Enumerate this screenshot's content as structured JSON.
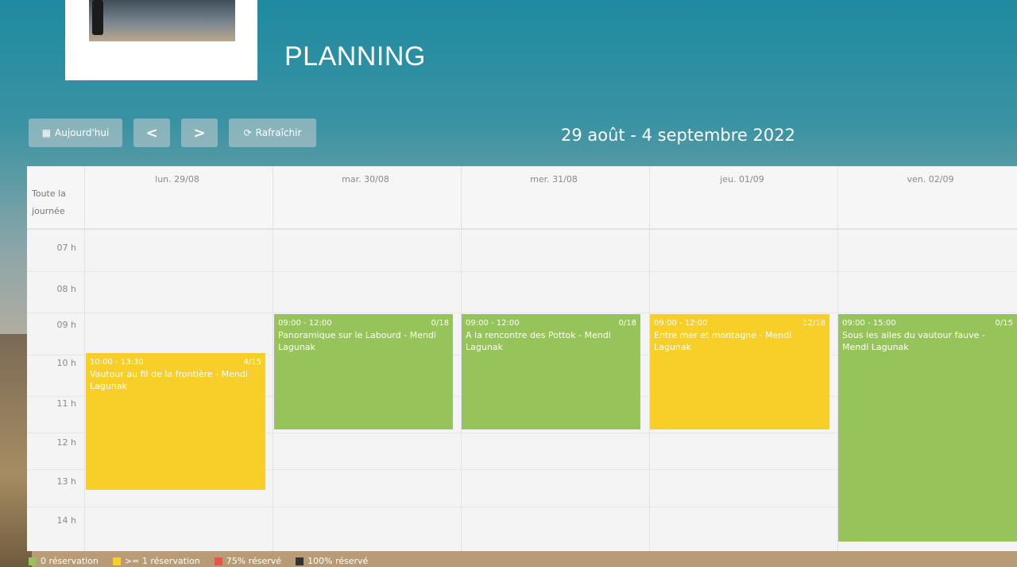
{
  "header": {
    "title": "PLANNING",
    "range": "29 août - 4 septembre 2022"
  },
  "toolbar": {
    "today_label": "Aujourd'hui",
    "prev_label": "<",
    "next_label": ">",
    "refresh_label": "Rafraîchir"
  },
  "calendar": {
    "allday_label_line1": "Toute la",
    "allday_label_line2": "journée",
    "days": [
      {
        "label": "lun. 29/08"
      },
      {
        "label": "mar. 30/08"
      },
      {
        "label": "mer. 31/08"
      },
      {
        "label": "jeu. 01/09"
      },
      {
        "label": "ven. 02/09"
      }
    ],
    "hours": [
      "07 h",
      "08 h",
      "09 h",
      "10 h",
      "11 h",
      "12 h",
      "13 h",
      "14 h"
    ],
    "events": [
      {
        "time": "10:00 - 13:30",
        "count": "4/15",
        "title": "Vautour au fil de la frontière - Mendi Lagunak",
        "status": "yellow"
      },
      {
        "time": "09:00 - 12:00",
        "count": "0/18",
        "title": "Panoramique sur le Labourd - Mendi Lagunak",
        "status": "green"
      },
      {
        "time": "09:00 - 12:00",
        "count": "0/18",
        "title": "A la rencontre des Pottok - Mendi Lagunak",
        "status": "green"
      },
      {
        "time": "09:00 - 12:00",
        "count": "12/18",
        "title": "Entre mer et montagne - Mendi Lagunak",
        "status": "yellow"
      },
      {
        "time": "09:00 - 15:00",
        "count": "0/15",
        "title": "Sous les ailes du vautour fauve - Mendi Lagunak",
        "status": "green"
      }
    ]
  },
  "legend": [
    {
      "label": "0 réservation",
      "color": "#96c35a"
    },
    {
      "label": ">= 1 réservation",
      "color": "#f8ce28"
    },
    {
      "label": "75% réservé",
      "color": "#e8564a"
    },
    {
      "label": "100% réservé",
      "color": "#333333"
    }
  ]
}
